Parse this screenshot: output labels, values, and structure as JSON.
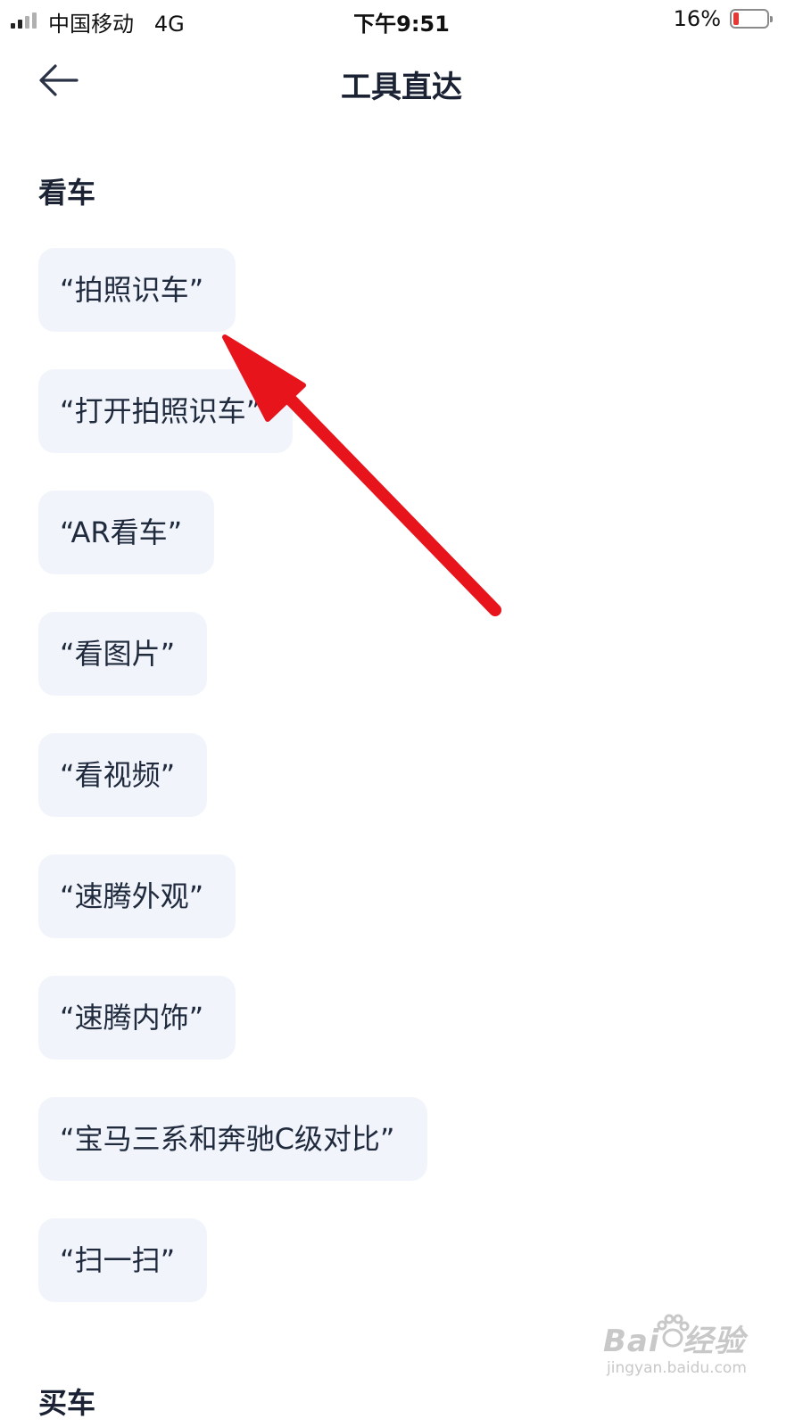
{
  "status_bar": {
    "carrier": "中国移动   4G",
    "time": "下午9:51",
    "battery_percent_text": "16%",
    "battery_level": 0.16,
    "battery_color": "#e53935",
    "signal_bars_active": 2,
    "signal_bars_total": 4
  },
  "nav_bar": {
    "back_icon": "arrow-left-icon",
    "title": "工具直达"
  },
  "section": {
    "title": "看车",
    "chips": [
      "“拍照识车”",
      "“打开拍照识车”",
      "“AR看车”",
      "“看图片”",
      "“看视频”",
      "“速腾外观”",
      "“速腾内饰”",
      "“宝马三系和奔驰C级对比”",
      "“扫一扫”"
    ]
  },
  "next_section": {
    "title": "买车"
  },
  "annotation": {
    "type": "arrow",
    "color": "#e8141c",
    "points_to": "“拍照识车”"
  },
  "watermark": {
    "brand": "Bai  经验",
    "url": "jingyan.baidu.com"
  },
  "colors": {
    "chip_background": "#f2f4fb",
    "text_primary": "#1a2233"
  }
}
